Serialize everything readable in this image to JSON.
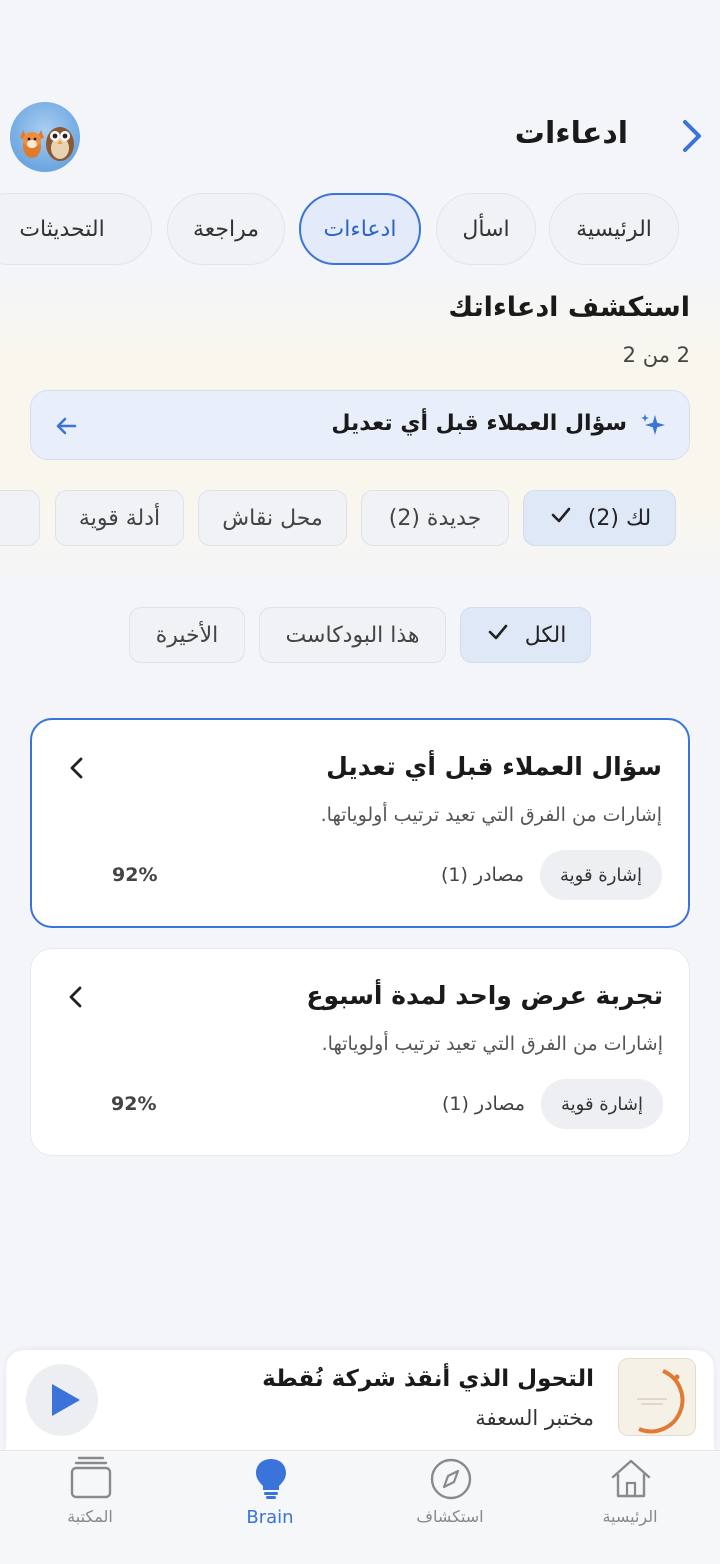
{
  "header": {
    "title": "ادعاءات"
  },
  "tabs": [
    {
      "label": "الرئيسية",
      "active": false
    },
    {
      "label": "اسأل",
      "active": false
    },
    {
      "label": "ادعاءات",
      "active": true
    },
    {
      "label": "مراجعة",
      "active": false
    },
    {
      "label": "التحديثات",
      "active": false
    }
  ],
  "section": {
    "title": "استكشف ادعاءاتك",
    "count": "2 من 2"
  },
  "selector": {
    "text": "سؤال العملاء قبل أي تعديل"
  },
  "filters": [
    {
      "label": "لك (2)",
      "active": true
    },
    {
      "label": "جديدة (2)",
      "active": false
    },
    {
      "label": "محل نقاش",
      "active": false
    },
    {
      "label": "أدلة قوية",
      "active": false
    }
  ],
  "scope": [
    {
      "label": "الكل",
      "active": true
    },
    {
      "label": "هذا البودكاست",
      "active": false
    },
    {
      "label": "الأخيرة",
      "active": false
    }
  ],
  "cards": [
    {
      "title": "سؤال العملاء قبل أي تعديل",
      "description": "إشارات من الفرق التي تعيد ترتيب أولوياتها.",
      "badge": "إشارة قوية",
      "sources": "مصادر (1)",
      "percent": "92%",
      "selected": true
    },
    {
      "title": "تجربة عرض واحد لمدة أسبوع",
      "description": "إشارات من الفرق التي تعيد ترتيب أولوياتها.",
      "badge": "إشارة قوية",
      "sources": "مصادر (1)",
      "percent": "92%",
      "selected": false
    }
  ],
  "player": {
    "title": "التحول الذي أنقذ شركة نُقطة",
    "subtitle": "مختبر السعفة",
    "thumb_text": "مختبر السعفة"
  },
  "nav": [
    {
      "label": "الرئيسية",
      "icon": "home-icon",
      "active": false
    },
    {
      "label": "استكشاف",
      "icon": "compass-icon",
      "active": false
    },
    {
      "label": "Brain",
      "icon": "lightbulb-icon",
      "active": true
    },
    {
      "label": "المكتبة",
      "icon": "library-icon",
      "active": false
    }
  ],
  "colors": {
    "accent": "#3a73d9",
    "background": "#f3f5f9",
    "chip_active": "#dfe8f7"
  }
}
